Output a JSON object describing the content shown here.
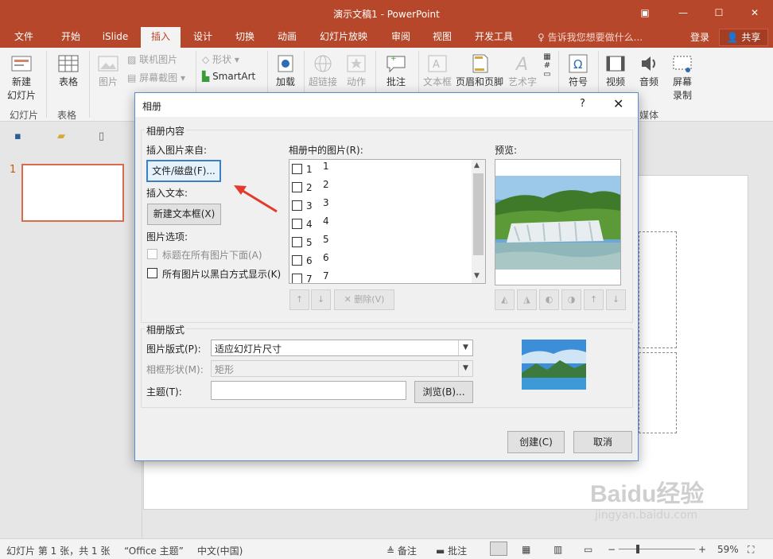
{
  "window": {
    "title": "演示文稿1 - PowerPoint"
  },
  "tabs": [
    "文件",
    "开始",
    "iSlide",
    "插入",
    "设计",
    "切换",
    "动画",
    "幻灯片放映",
    "审阅",
    "视图",
    "开发工具"
  ],
  "tell_me": "告诉我您想要做什么...",
  "login": "登录",
  "share": "共享",
  "ribbon": {
    "new_slide": "新建",
    "new_slide2": "幻灯片",
    "slides_group": "幻灯片",
    "table": "表格",
    "table_group": "表格",
    "picture": "图片",
    "online_pictures": "联机图片",
    "screenshot": "屏幕截图",
    "shapes": "形状",
    "smartart": "SmartArt",
    "addins": "加载",
    "hyperlink": "超链接",
    "action": "动作",
    "comment": "批注",
    "textbox": "文本框",
    "header_footer": "页眉和页脚",
    "wordart": "艺术字",
    "symbol": "符号",
    "video": "视频",
    "audio": "音频",
    "screen_record": "屏幕",
    "screen_record2": "录制",
    "media_group": "媒体"
  },
  "left_pane": {
    "slide_number": "1"
  },
  "status": {
    "slide_info": "幻灯片 第 1 张，共 1 张",
    "theme": "“Office 主题”",
    "language": "中文(中国)",
    "notes": "备注",
    "comments": "批注",
    "zoom": "59%"
  },
  "dialog": {
    "title": "相册",
    "help": "?",
    "album_content": "相册内容",
    "insert_picture_from": "插入图片来自:",
    "file_disk_button": "文件/磁盘(F)...",
    "insert_text": "插入文本:",
    "new_textbox_button": "新建文本框(X)",
    "picture_options": "图片选项:",
    "captions_below": "标题在所有图片下面(A)",
    "black_white": "所有图片以黑白方式显示(K)",
    "pictures_in_album": "相册中的图片(R):",
    "list_items": [
      {
        "n1": "1",
        "n2": "1"
      },
      {
        "n1": "2",
        "n2": "2"
      },
      {
        "n1": "3",
        "n2": "3"
      },
      {
        "n1": "4",
        "n2": "4"
      },
      {
        "n1": "5",
        "n2": "5"
      },
      {
        "n1": "6",
        "n2": "6"
      },
      {
        "n1": "7",
        "n2": "7"
      }
    ],
    "delete_button": "删除(V)",
    "preview_label": "预览:",
    "album_layout": "相册版式",
    "picture_layout_label": "图片版式(P):",
    "picture_layout_value": "适应幻灯片尺寸",
    "frame_shape_label": "相框形状(M):",
    "frame_shape_value": "矩形",
    "theme_label": "主题(T):",
    "theme_value": "",
    "browse_button": "浏览(B)...",
    "create_button": "创建(C)",
    "cancel_button": "取消"
  },
  "watermark": {
    "line1": "Baidu经验",
    "line2": "jingyan.baidu.com"
  },
  "colors": {
    "accent": "#b7472a",
    "dialog_border": "#5b8fcb",
    "focus_border": "#3c7fc9"
  }
}
